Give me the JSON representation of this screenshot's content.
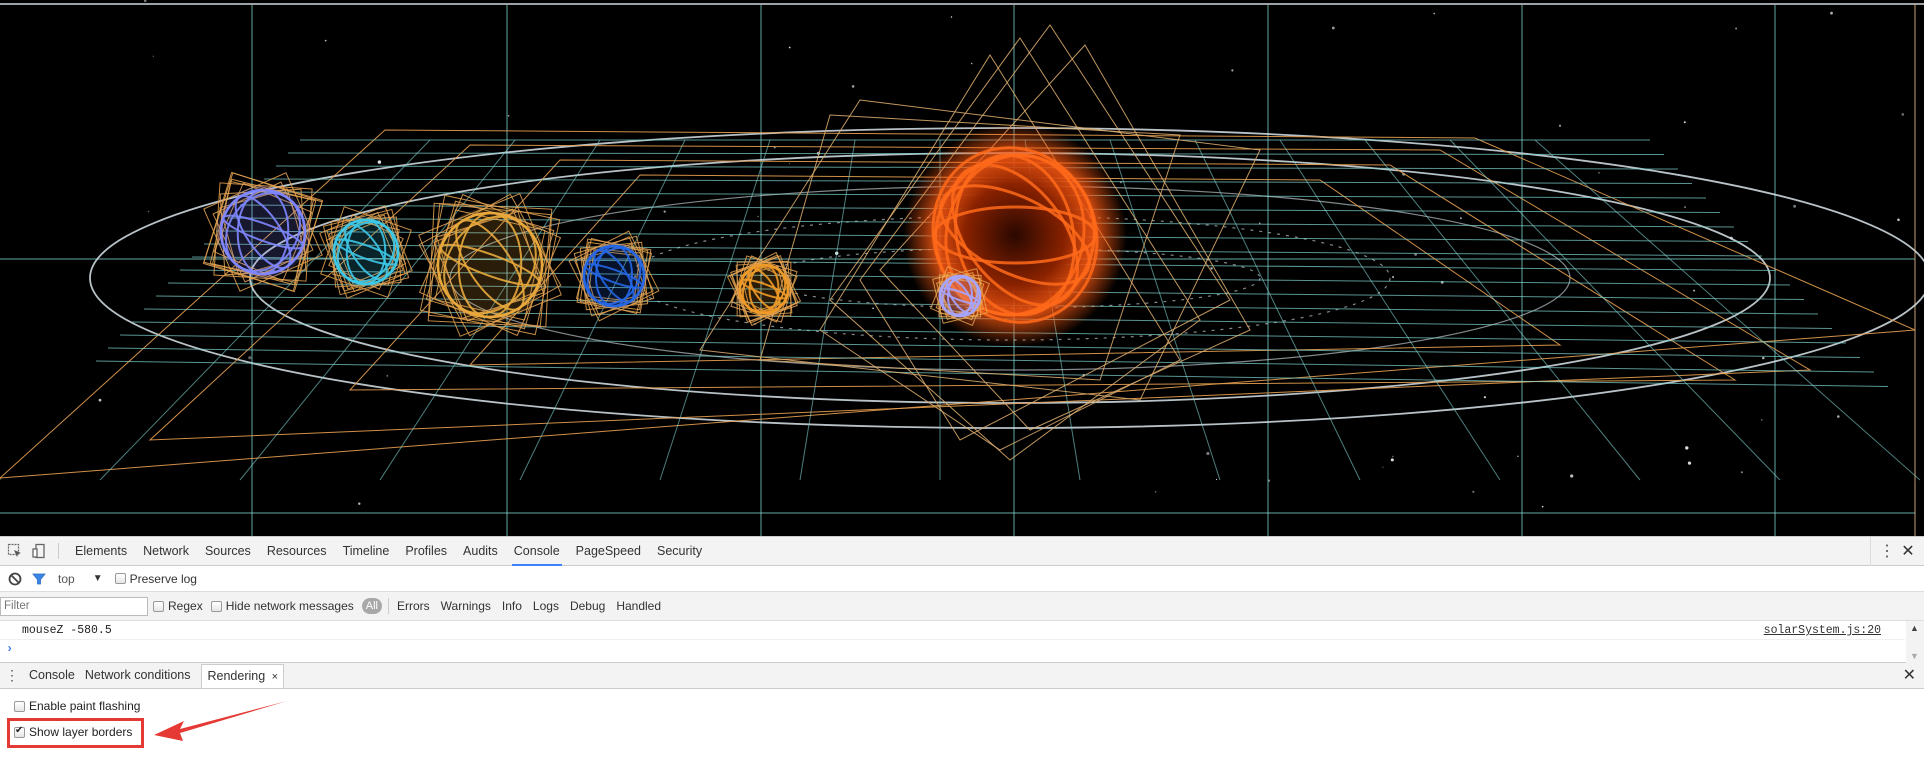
{
  "viewport": {
    "description": "WebGL solar system scene with layer borders shown",
    "background_color": "#000000",
    "layer_border_colors": {
      "tile_grid": "#7fd4d0",
      "layer": "#e8a050",
      "orbit": "#d8e4ea"
    },
    "planets": [
      {
        "name": "violet-planet",
        "color": "#7f86ff"
      },
      {
        "name": "cyan-planet",
        "color": "#3cc8e8"
      },
      {
        "name": "gold-planet",
        "color": "#e8a83c"
      },
      {
        "name": "blue-planet",
        "color": "#2466e6"
      },
      {
        "name": "orange-small-planet",
        "color": "#f09a28"
      },
      {
        "name": "sun",
        "color": "#ff5a12"
      },
      {
        "name": "small-lavender-planet",
        "color": "#a7a4ff"
      }
    ]
  },
  "devtools": {
    "main_tabs": [
      "Elements",
      "Network",
      "Sources",
      "Resources",
      "Timeline",
      "Profiles",
      "Audits",
      "Console",
      "PageSpeed",
      "Security"
    ],
    "active_main_tab": "Console",
    "icons": {
      "inspect": "inspect-element-icon",
      "device": "device-mode-icon",
      "more": "kebab-menu-icon",
      "close": "close-icon"
    },
    "console_toolbar": {
      "context": "top",
      "preserve_log_label": "Preserve log",
      "preserve_log_checked": false
    },
    "filter_bar": {
      "filter_placeholder": "Filter",
      "regex_label": "Regex",
      "hide_network_label": "Hide network messages",
      "all_label": "All",
      "levels": [
        "Errors",
        "Warnings",
        "Info",
        "Logs",
        "Debug",
        "Handled"
      ]
    },
    "messages": [
      {
        "text": "mouseZ -580.5",
        "source": "solarSystem.js:20"
      }
    ],
    "prompt_symbol": "›",
    "drawer": {
      "tabs": [
        "Console",
        "Network conditions",
        "Rendering"
      ],
      "active_tab": "Rendering",
      "tab_close": "×",
      "close": "✕"
    },
    "rendering_options": [
      {
        "label": "Enable paint flashing",
        "checked": false
      },
      {
        "label": "Show layer borders",
        "checked": true
      }
    ],
    "annotation": {
      "color": "#e53935",
      "target": "Show layer borders"
    }
  }
}
